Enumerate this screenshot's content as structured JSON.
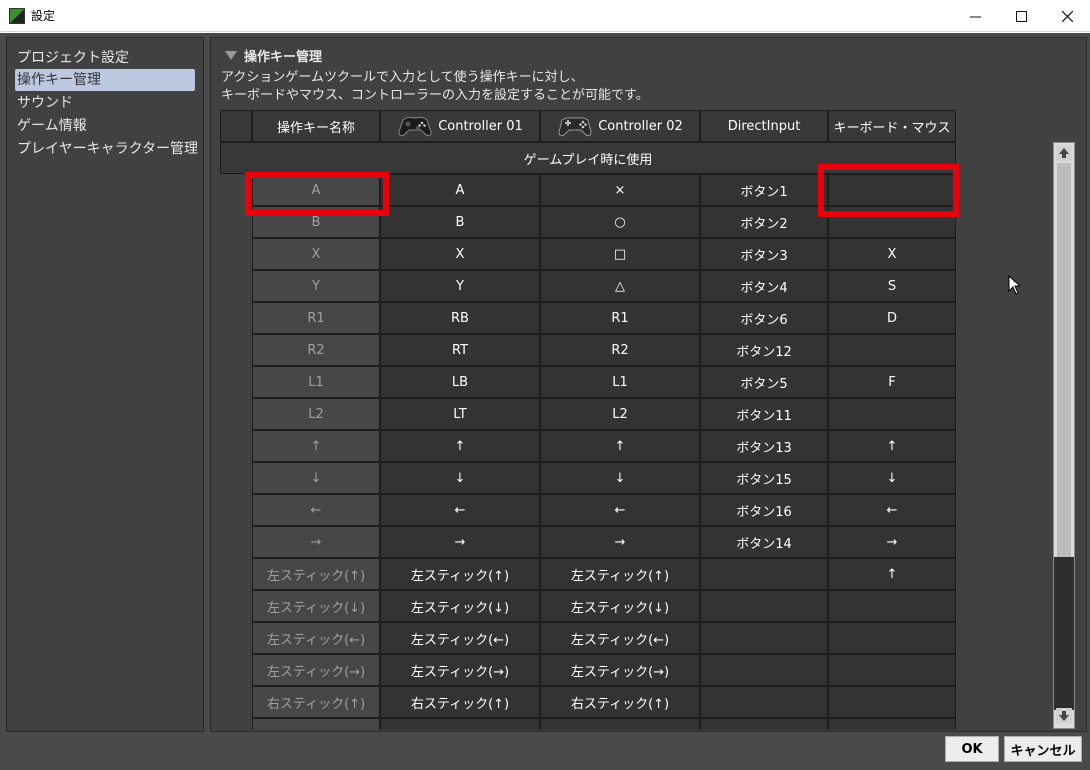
{
  "window": {
    "title": "設定"
  },
  "sidebar": {
    "items": [
      {
        "label": "プロジェクト設定"
      },
      {
        "label": "操作キー管理",
        "selected": true
      },
      {
        "label": "サウンド"
      },
      {
        "label": "ゲーム情報"
      },
      {
        "label": "プレイヤーキャラクター管理"
      }
    ]
  },
  "section": {
    "title": "操作キー管理",
    "description_line1": "アクションゲームツクールで入力として使う操作キーに対し、",
    "description_line2": "キーボードやマウス、コントローラーの入力を設定することが可能です。"
  },
  "table": {
    "headers": [
      "操作キー名称",
      "Controller 01",
      "Controller 02",
      "DirectInput",
      "キーボード・マウス"
    ],
    "group_label": "ゲームプレイ時に使用",
    "rows": [
      [
        "A",
        "A",
        "×",
        "ボタン1",
        ""
      ],
      [
        "B",
        "B",
        "○",
        "ボタン2",
        ""
      ],
      [
        "X",
        "X",
        "□",
        "ボタン3",
        "X"
      ],
      [
        "Y",
        "Y",
        "△",
        "ボタン4",
        "S"
      ],
      [
        "R1",
        "RB",
        "R1",
        "ボタン6",
        "D"
      ],
      [
        "R2",
        "RT",
        "R2",
        "ボタン12",
        ""
      ],
      [
        "L1",
        "LB",
        "L1",
        "ボタン5",
        "F"
      ],
      [
        "L2",
        "LT",
        "L2",
        "ボタン11",
        ""
      ],
      [
        "↑",
        "↑",
        "↑",
        "ボタン13",
        "↑"
      ],
      [
        "↓",
        "↓",
        "↓",
        "ボタン15",
        "↓"
      ],
      [
        "←",
        "←",
        "←",
        "ボタン16",
        "←"
      ],
      [
        "→",
        "→",
        "→",
        "ボタン14",
        "→"
      ],
      [
        "左スティック(↑)",
        "左スティック(↑)",
        "左スティック(↑)",
        "",
        "↑"
      ],
      [
        "左スティック(↓)",
        "左スティック(↓)",
        "左スティック(↓)",
        "",
        ""
      ],
      [
        "左スティック(←)",
        "左スティック(←)",
        "左スティック(←)",
        "",
        ""
      ],
      [
        "左スティック(→)",
        "左スティック(→)",
        "左スティック(→)",
        "",
        ""
      ],
      [
        "右スティック(↑)",
        "右スティック(↑)",
        "右スティック(↑)",
        "",
        ""
      ],
      [
        "",
        "",
        "",
        "",
        ""
      ]
    ]
  },
  "buttons": {
    "ok": "OK",
    "cancel": "キャンセル"
  },
  "colors": {
    "highlight": "#e8000b",
    "background": "#4a4a4a",
    "cell": "#333333"
  },
  "icons": [
    "gamepad-icon",
    "scroll-up-icon",
    "scroll-down-icon",
    "minimize-icon",
    "maximize-icon",
    "close-icon",
    "mouse-cursor-icon"
  ]
}
